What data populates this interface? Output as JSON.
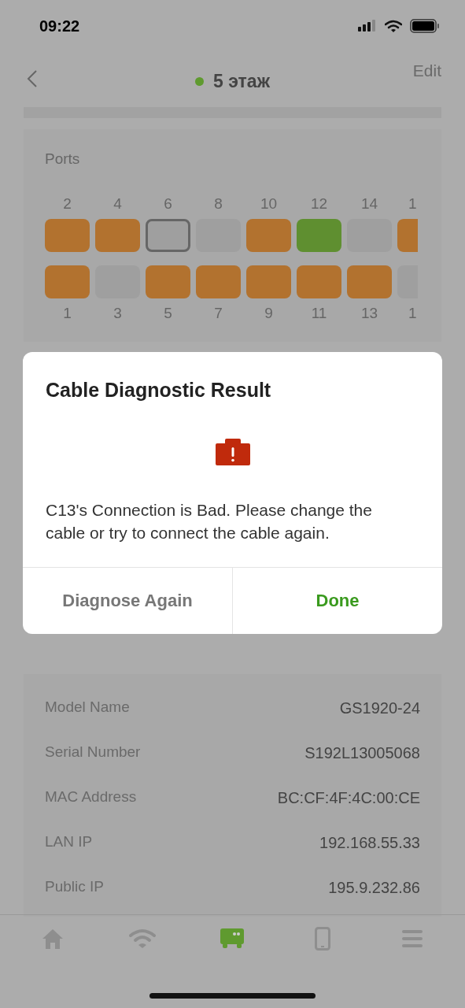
{
  "status_bar": {
    "time": "09:22"
  },
  "header": {
    "title": "5 этаж",
    "online": true,
    "action": "Edit"
  },
  "ports": {
    "title": "Ports",
    "top": [
      {
        "label": "2",
        "color": "#b2722f",
        "selected": false
      },
      {
        "label": "4",
        "color": "#b2722f",
        "selected": false
      },
      {
        "label": "6",
        "color": "#9f9f9f",
        "selected": true
      },
      {
        "label": "8",
        "color": "#9f9f9f",
        "selected": false
      },
      {
        "label": "10",
        "color": "#b2722f",
        "selected": false
      },
      {
        "label": "12",
        "color": "#5f8f30",
        "selected": false
      },
      {
        "label": "14",
        "color": "#9f9f9f",
        "selected": false
      },
      {
        "label": "1",
        "color": "#b2722f",
        "selected": false
      }
    ],
    "bottom": [
      {
        "label": "1",
        "color": "#b2722f",
        "selected": false
      },
      {
        "label": "3",
        "color": "#9f9f9f",
        "selected": false
      },
      {
        "label": "5",
        "color": "#b2722f",
        "selected": false
      },
      {
        "label": "7",
        "color": "#b2722f",
        "selected": false
      },
      {
        "label": "9",
        "color": "#b2722f",
        "selected": false
      },
      {
        "label": "11",
        "color": "#b2722f",
        "selected": false
      },
      {
        "label": "13",
        "color": "#b2722f",
        "selected": false
      },
      {
        "label": "1",
        "color": "#9f9f9f",
        "selected": false
      }
    ]
  },
  "dialog": {
    "title": "Cable Diagnostic Result",
    "message": "C13's Connection is Bad. Please change the cable or try to connect the cable again.",
    "buttons": [
      {
        "label": "Diagnose Again",
        "kind": "secondary"
      },
      {
        "label": "Done",
        "kind": "primary"
      }
    ]
  },
  "info": [
    {
      "label": "Model Name",
      "value": "GS1920-24"
    },
    {
      "label": "Serial Number",
      "value": "S192L13005068"
    },
    {
      "label": "MAC Address",
      "value": "BC:CF:4F:4C:00:CE"
    },
    {
      "label": "LAN IP",
      "value": "192.168.55.33"
    },
    {
      "label": "Public IP",
      "value": "195.9.232.86"
    }
  ],
  "tab_bar": [
    {
      "kind": "home",
      "selected": false
    },
    {
      "kind": "wifi",
      "selected": false
    },
    {
      "kind": "switch",
      "selected": true
    },
    {
      "kind": "phone",
      "selected": false
    },
    {
      "kind": "menu",
      "selected": false
    }
  ]
}
